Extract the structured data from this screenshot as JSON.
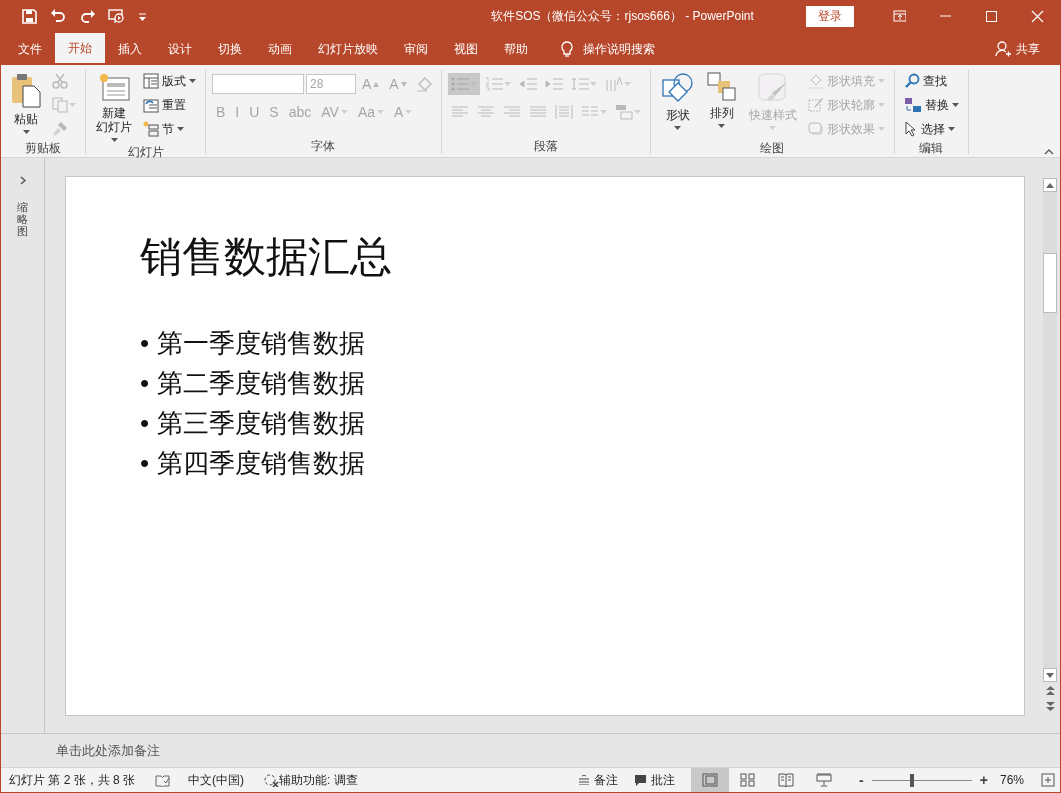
{
  "title_bar": {
    "title": "软件SOS（微信公众号：rjsos666） - PowerPoint",
    "login": "登录"
  },
  "tabs": [
    {
      "label": "文件",
      "selected": false
    },
    {
      "label": "开始",
      "selected": true
    },
    {
      "label": "插入",
      "selected": false
    },
    {
      "label": "设计",
      "selected": false
    },
    {
      "label": "切换",
      "selected": false
    },
    {
      "label": "动画",
      "selected": false
    },
    {
      "label": "幻灯片放映",
      "selected": false
    },
    {
      "label": "审阅",
      "selected": false
    },
    {
      "label": "视图",
      "selected": false
    },
    {
      "label": "帮助",
      "selected": false
    }
  ],
  "tell_me": "操作说明搜索",
  "share": "共享",
  "ribbon": [
    {
      "label": "剪贴板",
      "stacks": [
        {
          "items": [
            {
              "kind": "large",
              "label_lines": [
                "粘贴"
              ],
              "dropdown": true,
              "disabled": false
            }
          ]
        },
        {
          "items": [
            {
              "kind": "icon",
              "dropdown": false,
              "disabled": true
            },
            {
              "kind": "icon",
              "dropdown": true,
              "disabled": true
            },
            {
              "kind": "icon",
              "dropdown": false,
              "disabled": true
            }
          ]
        }
      ]
    },
    {
      "label": "幻灯片",
      "stacks": [
        {
          "items": [
            {
              "kind": "large",
              "label_lines": [
                "新建",
                "幻灯片"
              ],
              "dropdown": true,
              "disabled": false
            }
          ]
        },
        {
          "items": [
            {
              "kind": "small",
              "label": "版式",
              "dropdown": true,
              "disabled": false
            },
            {
              "kind": "small",
              "label": "重置",
              "dropdown": false,
              "disabled": false
            },
            {
              "kind": "small",
              "label": "节",
              "dropdown": true,
              "disabled": false
            }
          ]
        }
      ]
    },
    {
      "label": "字体",
      "toolbars": [
        {
          "items": [
            {
              "kind": "font_field",
              "disabled": true
            },
            {
              "kind": "size_field",
              "value": "28",
              "disabled": true
            },
            {
              "kind": "glyph",
              "label": "A",
              "dropdown": false,
              "disabled": true
            },
            {
              "kind": "glyph",
              "label": "A",
              "dropdown": false,
              "disabled": true
            },
            {
              "kind": "icon",
              "dropdown": false,
              "disabled": true
            }
          ]
        },
        {
          "items": [
            {
              "kind": "glyph",
              "label": "B",
              "dropdown": false,
              "disabled": true
            },
            {
              "kind": "glyph",
              "label": "I",
              "dropdown": false,
              "disabled": true
            },
            {
              "kind": "glyph",
              "label": "U",
              "dropdown": false,
              "disabled": true
            },
            {
              "kind": "glyph",
              "label": "S",
              "dropdown": false,
              "disabled": true
            },
            {
              "kind": "glyph",
              "label": "abc",
              "dropdown": false,
              "disabled": true
            },
            {
              "kind": "glyph",
              "label": "AV",
              "dropdown": true,
              "disabled": true
            },
            {
              "kind": "glyph",
              "label": "Aa",
              "dropdown": true,
              "disabled": true
            },
            {
              "kind": "glyph",
              "label": "A",
              "dropdown": true,
              "disabled": true
            }
          ]
        }
      ]
    },
    {
      "label": "段落",
      "toolbars": [
        {
          "items": [
            {
              "kind": "icon",
              "dropdown": true,
              "disabled": true,
              "pressed": true
            },
            {
              "kind": "icon",
              "dropdown": true,
              "disabled": true,
              "pressed": false
            },
            {
              "kind": "icon",
              "dropdown": false,
              "disabled": true,
              "pressed": false
            },
            {
              "kind": "icon",
              "dropdown": false,
              "disabled": true,
              "pressed": false
            },
            {
              "kind": "icon",
              "dropdown": true,
              "disabled": true,
              "pressed": false
            },
            {
              "kind": "icon",
              "dropdown": true,
              "disabled": true,
              "pressed": false
            }
          ]
        },
        {
          "items": [
            {
              "kind": "icon",
              "dropdown": false,
              "disabled": true
            },
            {
              "kind": "icon",
              "dropdown": false,
              "disabled": true
            },
            {
              "kind": "icon",
              "dropdown": false,
              "disabled": true
            },
            {
              "kind": "icon",
              "dropdown": false,
              "disabled": true
            },
            {
              "kind": "icon",
              "dropdown": false,
              "disabled": true
            },
            {
              "kind": "icon",
              "dropdown": true,
              "disabled": true
            },
            {
              "kind": "icon",
              "dropdown": true,
              "disabled": true
            }
          ]
        }
      ]
    },
    {
      "label": "绘图",
      "stacks": [
        {
          "items": [
            {
              "kind": "large",
              "label_lines": [
                "形状"
              ],
              "dropdown": true,
              "disabled": false
            }
          ]
        },
        {
          "items": [
            {
              "kind": "large",
              "label_lines": [
                "排列"
              ],
              "dropdown": true,
              "disabled": false
            }
          ]
        },
        {
          "items": [
            {
              "kind": "large",
              "label_lines": [
                "快速样式"
              ],
              "dropdown": true,
              "disabled": true
            }
          ]
        },
        {
          "items": [
            {
              "kind": "small",
              "label": "形状填充",
              "dropdown": true,
              "disabled": true
            },
            {
              "kind": "small",
              "label": "形状轮廓",
              "dropdown": true,
              "disabled": true
            },
            {
              "kind": "small",
              "label": "形状效果",
              "dropdown": true,
              "disabled": true
            }
          ]
        }
      ]
    },
    {
      "label": "编辑",
      "stacks": [
        {
          "items": [
            {
              "kind": "small",
              "label": "查找",
              "dropdown": false,
              "disabled": false
            },
            {
              "kind": "small",
              "label": "替换",
              "dropdown": true,
              "disabled": false
            },
            {
              "kind": "small",
              "label": "选择",
              "dropdown": true,
              "disabled": false
            }
          ]
        }
      ]
    }
  ],
  "thumbnails_label": "缩略图",
  "slide": {
    "title": "销售数据汇总",
    "bullet": "•",
    "bullets": [
      "第一季度销售数据",
      "第二季度销售数据",
      "第三季度销售数据",
      "第四季度销售数据"
    ]
  },
  "notes": {
    "placeholder": "单击此处添加备注"
  },
  "status_bar": {
    "slide_info": "幻灯片 第 2 张，共 8 张",
    "language": "中文(中国)",
    "accessibility": "辅助功能: 调查",
    "notes": "备注",
    "comments": "批注",
    "views": [
      {
        "selected": true
      },
      {
        "selected": false
      },
      {
        "selected": false
      },
      {
        "selected": false
      }
    ],
    "zoom_minus": "-",
    "zoom_plus": "+",
    "zoom": {
      "level": 0.4
    },
    "zoom_percent": "76%"
  }
}
